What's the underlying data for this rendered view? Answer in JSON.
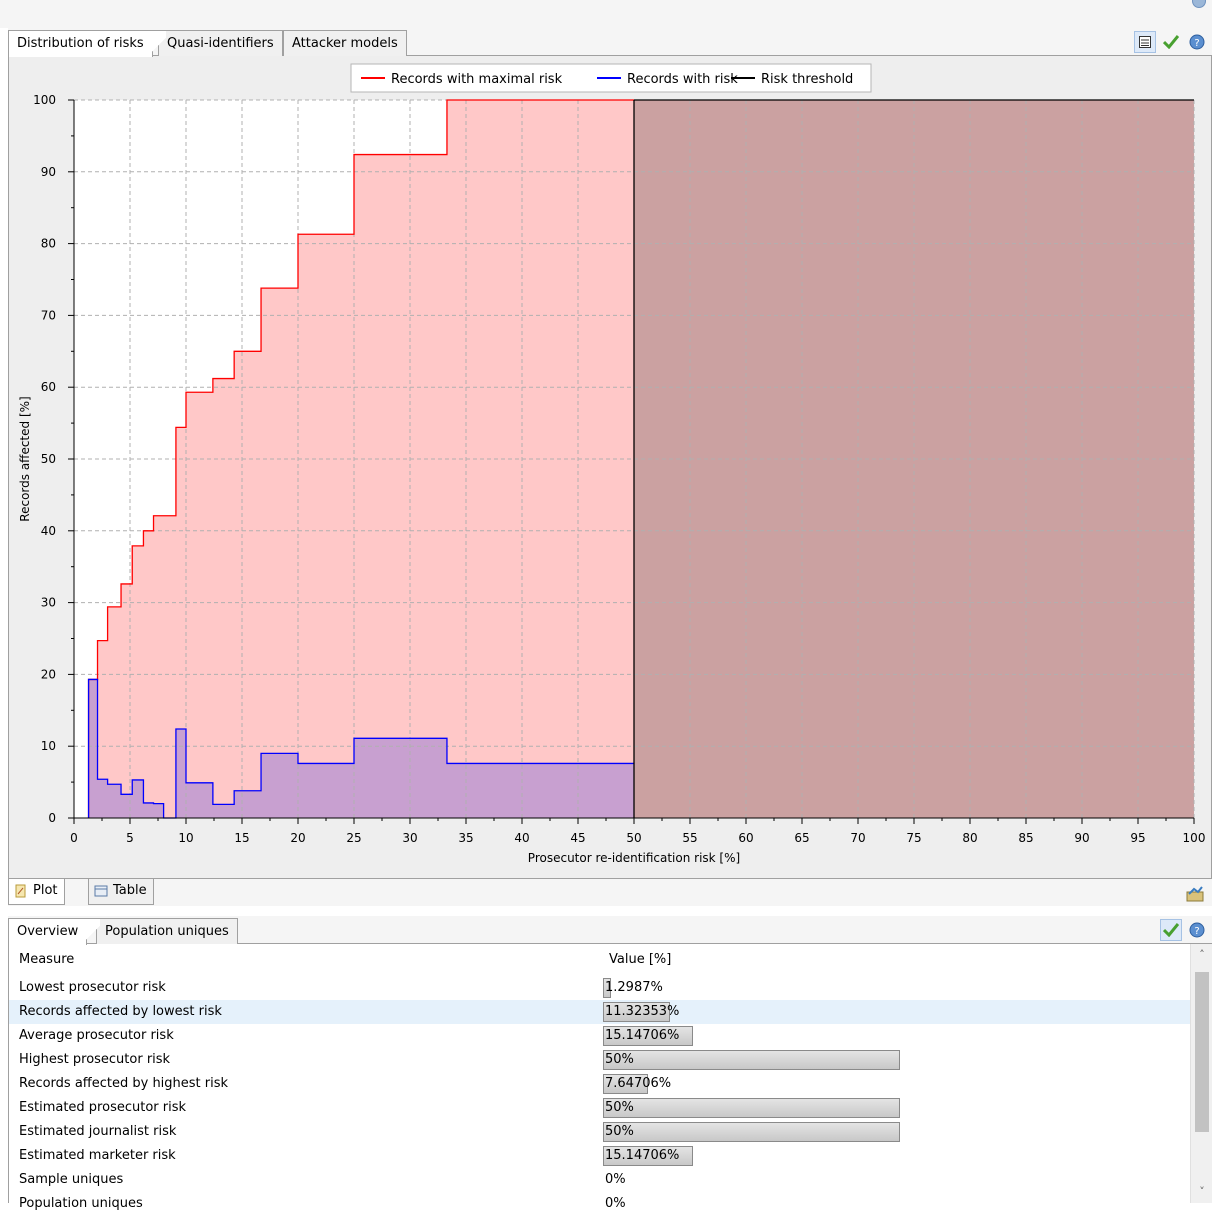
{
  "top_tabs": [
    "Distribution of risks",
    "Quasi-identifiers",
    "Attacker models"
  ],
  "plot_tabs": [
    "Plot",
    "Table"
  ],
  "overview_tabs": [
    "Overview",
    "Population uniques"
  ],
  "colors": {
    "max_risk": "#ff0000",
    "with_risk": "#0000ff",
    "threshold": "#000000",
    "max_fill": "#ffc8c8",
    "with_fill": "#c8a0d0",
    "beyond_fill": "#cba1a1"
  },
  "chart_data": {
    "type": "line",
    "xlabel": "Prosecutor re-identification risk [%]",
    "ylabel": "Records affected [%]",
    "xlim": [
      0,
      100
    ],
    "ylim": [
      0,
      100
    ],
    "x_ticks": [
      "0",
      "5",
      "10",
      "15",
      "20",
      "25",
      "30",
      "35",
      "40",
      "45",
      "50",
      "55",
      "60",
      "65",
      "70",
      "75",
      "80",
      "85",
      "90",
      "95",
      "100"
    ],
    "y_ticks": [
      "0",
      "10",
      "20",
      "30",
      "40",
      "50",
      "60",
      "70",
      "80",
      "90",
      "100"
    ],
    "legend": [
      "Records with maximal risk",
      "Records with risk",
      "Risk threshold"
    ],
    "threshold": 50,
    "series": [
      {
        "name": "Records with maximal risk",
        "step": [
          [
            1.3,
            19.3
          ],
          [
            2.1,
            24.7
          ],
          [
            3.0,
            29.4
          ],
          [
            4.2,
            32.6
          ],
          [
            5.2,
            37.9
          ],
          [
            6.2,
            40.0
          ],
          [
            7.1,
            42.1
          ],
          [
            9.1,
            54.4
          ],
          [
            10.0,
            59.3
          ],
          [
            12.4,
            61.2
          ],
          [
            14.3,
            65.0
          ],
          [
            16.7,
            73.8
          ],
          [
            20.0,
            81.3
          ],
          [
            25.0,
            92.4
          ],
          [
            33.3,
            100.0
          ],
          [
            50.0,
            100.0
          ]
        ]
      },
      {
        "name": "Records with risk",
        "step": [
          [
            1.3,
            19.3
          ],
          [
            2.1,
            5.4
          ],
          [
            3.0,
            4.7
          ],
          [
            4.2,
            3.3
          ],
          [
            5.2,
            5.3
          ],
          [
            6.2,
            2.1
          ],
          [
            7.1,
            2.0
          ],
          [
            8.0,
            0.0
          ],
          [
            9.1,
            12.4
          ],
          [
            10.0,
            4.9
          ],
          [
            12.4,
            1.9
          ],
          [
            14.3,
            3.8
          ],
          [
            16.7,
            9.0
          ],
          [
            20.0,
            7.6
          ],
          [
            25.0,
            11.1
          ],
          [
            33.3,
            7.6
          ],
          [
            50.0,
            7.6
          ]
        ]
      }
    ]
  },
  "table": {
    "headers": [
      "Measure",
      "Value [%]"
    ],
    "rows": [
      {
        "measure": "Lowest prosecutor risk",
        "value": "1.2987%",
        "pct": 1.2987
      },
      {
        "measure": "Records affected by lowest risk",
        "value": "11.32353%",
        "pct": 11.32353
      },
      {
        "measure": "Average prosecutor risk",
        "value": "15.14706%",
        "pct": 15.14706
      },
      {
        "measure": "Highest prosecutor risk",
        "value": "50%",
        "pct": 50
      },
      {
        "measure": "Records affected by highest risk",
        "value": "7.64706%",
        "pct": 7.64706
      },
      {
        "measure": "Estimated prosecutor risk",
        "value": "50%",
        "pct": 50
      },
      {
        "measure": "Estimated journalist risk",
        "value": "50%",
        "pct": 50
      },
      {
        "measure": "Estimated marketer risk",
        "value": "15.14706%",
        "pct": 15.14706
      },
      {
        "measure": "Sample uniques",
        "value": "0%",
        "pct": 0
      },
      {
        "measure": "Population uniques",
        "value": "0%",
        "pct": 0
      }
    ]
  }
}
